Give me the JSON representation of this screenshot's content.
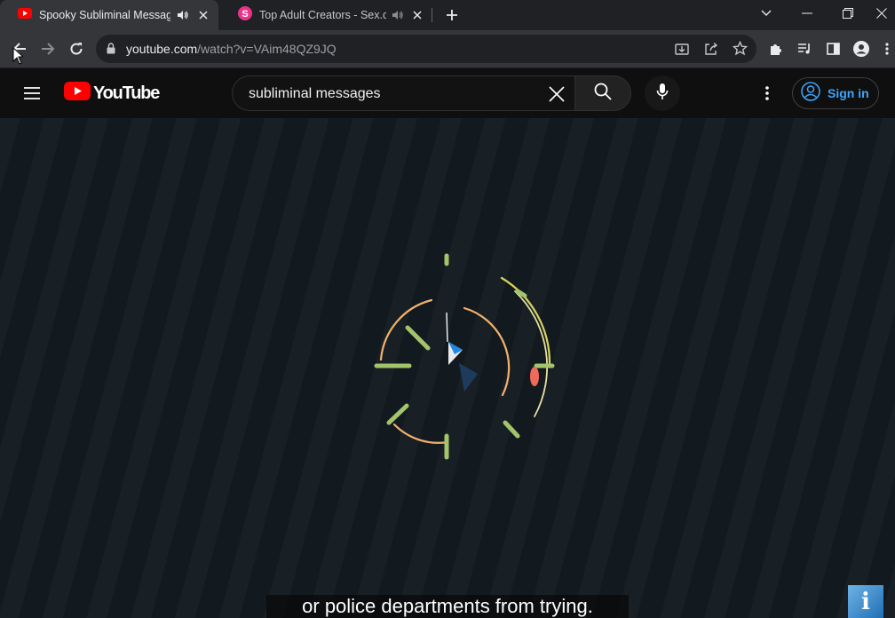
{
  "browser": {
    "tabs": [
      {
        "title": "Spooky Subliminal Message",
        "favicon": "youtube-icon",
        "active": true,
        "audio": "speaker-icon"
      },
      {
        "title": "Top Adult Creators - Sex.com",
        "favicon": "s-letter-icon",
        "active": false,
        "audio": "speaker-icon"
      }
    ],
    "url_host": "youtube.com",
    "url_path": "/watch?v=VAim48QZ9JQ"
  },
  "youtube": {
    "logo_text": "YouTube",
    "search_value": "subliminal messages",
    "signin_label": "Sign in"
  },
  "video": {
    "caption": "or police departments from trying.",
    "badge_glyph": "i"
  },
  "colors": {
    "accent_blue": "#3ea6ff",
    "youtube_red": "#ff0000",
    "ring_orange": "#f4b26b",
    "ring_green": "#a3c46a"
  }
}
